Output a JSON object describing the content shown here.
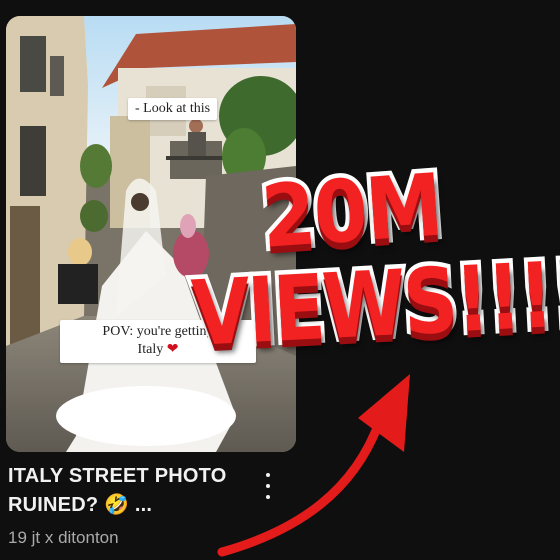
{
  "video": {
    "overlay_top": "- Look at this",
    "overlay_bottom_line1": "POV: you're getting",
    "overlay_bottom_line2": "Italy",
    "heart": "❤",
    "title": "ITALY STREET PHOTO RUINED? 🤣 ...",
    "meta": "19 jt x ditonton",
    "menu_icon": "more-vert-icon"
  },
  "headline": {
    "line1": "20M",
    "line2": "VIEWS!!!!"
  },
  "colors": {
    "background": "#0f0f0f",
    "headline_fill": "#f32222",
    "headline_stroke": "#ffffff",
    "arrow": "#e31b1b"
  }
}
